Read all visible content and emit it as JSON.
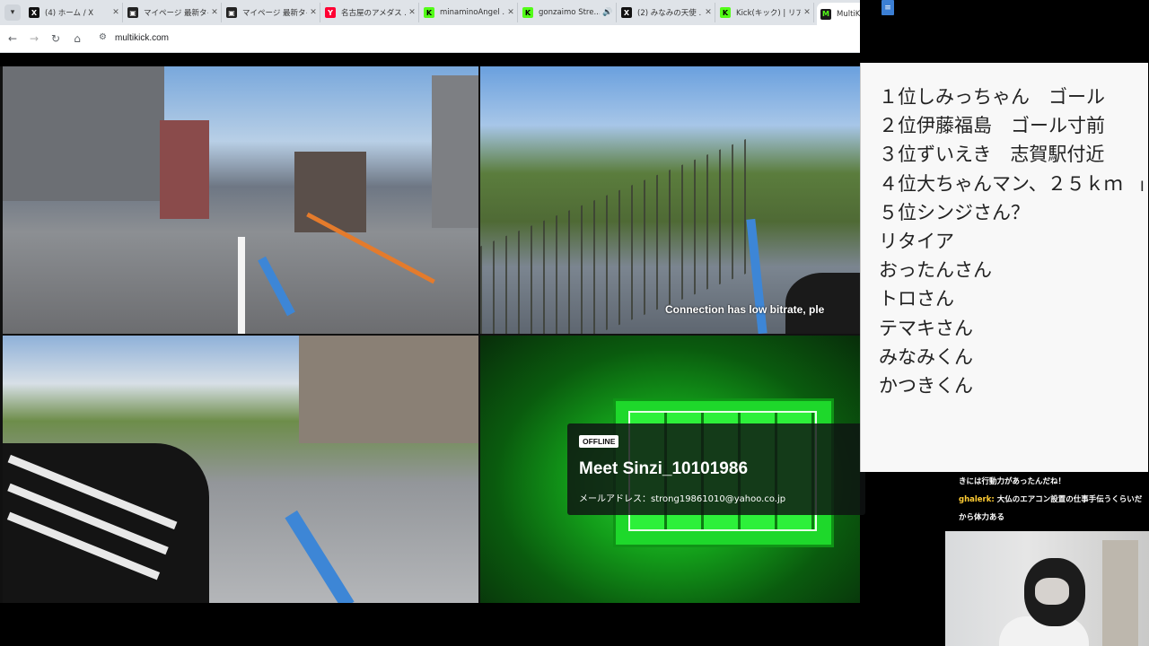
{
  "browser": {
    "tabs": [
      {
        "title": "(4) ホーム / X",
        "favicon": "x-logo-icon",
        "color": "#111111",
        "active": false
      },
      {
        "title": "マイページ 最新タイム",
        "favicon": "mypage-icon",
        "color": "#222222",
        "active": false
      },
      {
        "title": "マイページ 最新タイム",
        "favicon": "mypage-icon",
        "color": "#222222",
        "active": false
      },
      {
        "title": "名古屋のアメダス ...",
        "favicon": "yahoo-icon",
        "color": "#ff0033",
        "active": false
      },
      {
        "title": "minaminoAngel ...",
        "favicon": "kick-logo-icon",
        "color": "#53fc18",
        "active": false
      },
      {
        "title": "gonzaimo Stre...",
        "favicon": "kick-logo-icon",
        "color": "#53fc18",
        "active": false
      },
      {
        "title": "(2) みなみの天使 ...",
        "favicon": "x-logo-icon",
        "color": "#111111",
        "active": false
      },
      {
        "title": "Kick(キック) | リアル...",
        "favicon": "kick-logo-icon",
        "color": "#53fc18",
        "active": false
      },
      {
        "title": "MultiK",
        "favicon": "multikick-icon",
        "color": "#1a1a1a",
        "active": true
      }
    ],
    "url": "multikick.com"
  },
  "streams": {
    "low_bitrate_notice": "Connection has low bitrate, ple",
    "offline": {
      "badge": "OFFLINE",
      "name": "Meet Sinzi_10101986",
      "description": "メールアドレス：strong19861010@yahoo.co.jp"
    }
  },
  "ranking": {
    "items": [
      "１位しみっちゃん　ゴール",
      "２位伊藤福島　ゴール寸前",
      "３位ずいえき　志賀駅付近",
      "４位大ちゃんマン、２５ｋｍ",
      "５位シンジさん？",
      "リタイア",
      "おったんさん",
      "トロさん",
      "テマキさん",
      "みなみくん",
      "かつきくん"
    ]
  },
  "chat": {
    "line1": "きには行動力があったんだね！",
    "user": "ghalerk:",
    "message": "大仏のエアコン設置の仕事手伝うくらいだから体力ある"
  }
}
